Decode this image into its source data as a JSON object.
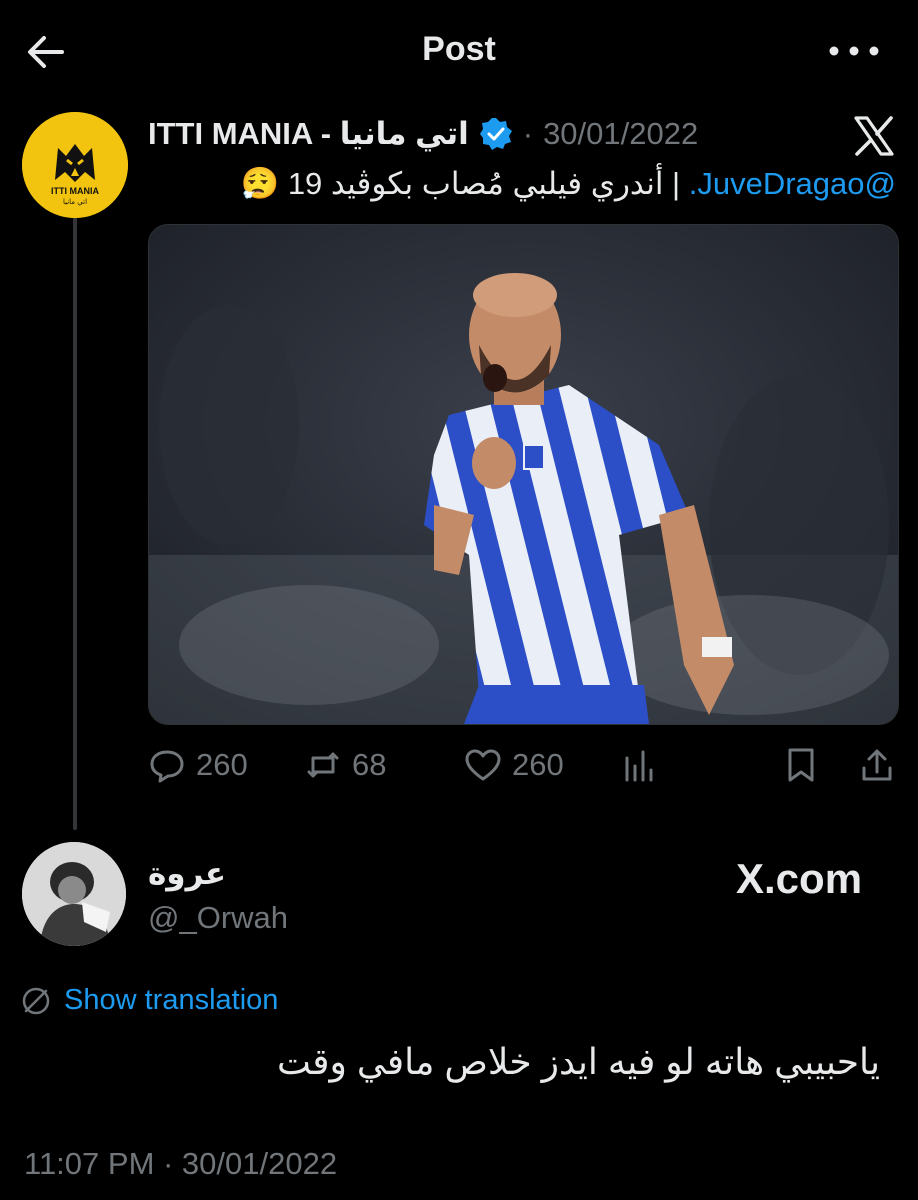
{
  "header": {
    "title": "Post",
    "back_icon": "arrow-left-icon",
    "more_icon": "more-horizontal-icon"
  },
  "quoted_post": {
    "avatar_text": "ITTI MANIA",
    "avatar_subtext": "اتي مانيا",
    "author_name": "ITTI MANIA - اتي مانيا",
    "date": "30/01/2022",
    "separator": "·",
    "text_mention": "@JuveDragao.",
    "text_body": " | أندري فيلبي مُصاب بكوڤيد 19 😮‍💨",
    "stats": {
      "replies": "260",
      "reposts": "68",
      "likes": "260"
    }
  },
  "reply": {
    "display_name": "عروة",
    "handle": "@_Orwah",
    "watermark": "X.com",
    "show_translation": "Show translation",
    "text": "ياحبيبي هاته لو فيه ايدز خلاص مافي وقت",
    "timestamp": "11:07 PM · 30/01/2022"
  },
  "colors": {
    "background": "#000000",
    "text": "#e7e9ea",
    "muted": "#71767b",
    "accent": "#1d9bf0",
    "avatar_bg": "#f2c40f"
  }
}
